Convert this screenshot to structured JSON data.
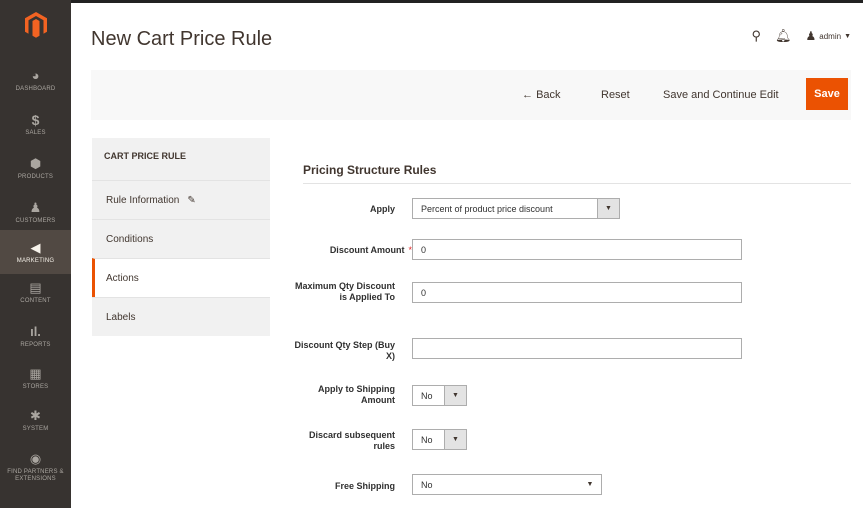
{
  "sidebar": {
    "items": [
      {
        "label": "DASHBOARD",
        "icon": "dashboard-icon"
      },
      {
        "label": "SALES",
        "icon": "dollar-icon"
      },
      {
        "label": "PRODUCTS",
        "icon": "cube-icon"
      },
      {
        "label": "CUSTOMERS",
        "icon": "person-icon"
      },
      {
        "label": "MARKETING",
        "icon": "megaphone-icon"
      },
      {
        "label": "CONTENT",
        "icon": "content-icon"
      },
      {
        "label": "REPORTS",
        "icon": "bar-chart-icon"
      },
      {
        "label": "STORES",
        "icon": "store-icon"
      },
      {
        "label": "SYSTEM",
        "icon": "gear-icon"
      },
      {
        "label": "FIND PARTNERS & EXTENSIONS",
        "icon": "partners-icon"
      }
    ]
  },
  "header": {
    "title": "New Cart Price Rule",
    "user": "admin"
  },
  "actions": {
    "back": "Back",
    "reset": "Reset",
    "save_continue": "Save and Continue Edit",
    "save": "Save"
  },
  "tabs": {
    "heading": "CART PRICE RULE",
    "items": [
      "Rule Information",
      "Conditions",
      "Actions",
      "Labels"
    ]
  },
  "form": {
    "section_title": "Pricing Structure Rules",
    "apply_label": "Apply",
    "apply_value": "Percent of product price discount",
    "discount_amount_label": "Discount Amount",
    "discount_amount_value": "0",
    "max_qty_label": "Maximum Qty Discount is Applied To",
    "max_qty_value": "0",
    "qty_step_label": "Discount Qty Step (Buy X)",
    "qty_step_value": "",
    "apply_shipping_label": "Apply to Shipping Amount",
    "apply_shipping_value": "No",
    "discard_label": "Discard subsequent rules",
    "discard_value": "No",
    "free_shipping_label": "Free Shipping",
    "free_shipping_value": "No"
  },
  "colors": {
    "accent": "#eb5202",
    "sidebar": "#373330"
  }
}
